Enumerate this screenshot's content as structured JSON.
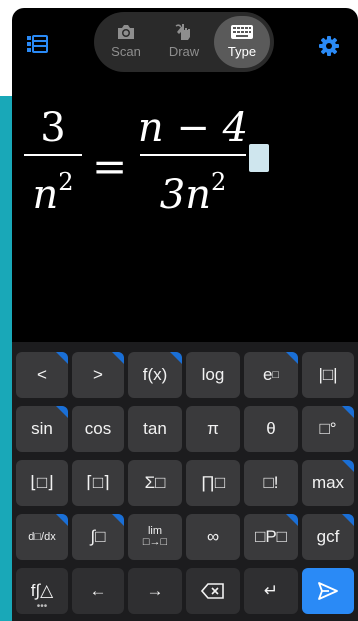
{
  "modes": {
    "scan_label": "Scan",
    "draw_label": "Draw",
    "type_label": "Type",
    "selected": "Type"
  },
  "equation": {
    "left_numerator": "3",
    "left_denominator": "n",
    "left_denominator_exponent": "2",
    "equals": "=",
    "right_numerator": "n − 4",
    "right_denominator": "3n",
    "right_denominator_exponent": "2"
  },
  "keys": {
    "row1": [
      "<",
      ">",
      "f(x)",
      "log",
      "e",
      "|□|"
    ],
    "row2": [
      "sin",
      "cos",
      "tan",
      "π",
      "θ",
      "□°"
    ],
    "row3": [
      "⌊□⌋",
      "⌈□⌉",
      "Σ□",
      "∏□",
      "□!",
      "max"
    ],
    "row4": [
      "d□/dx",
      "∫□",
      "lim",
      "∞",
      "□P□",
      "gcf"
    ],
    "row5": [
      "f∫△",
      "←",
      "→",
      "⌫",
      "↵",
      "send"
    ]
  },
  "colors": {
    "accent": "#2a8af6",
    "key_bg": "#3a3a3c",
    "keyboard_bg": "#1c1c1e",
    "side_strip": "#19a8b8"
  }
}
